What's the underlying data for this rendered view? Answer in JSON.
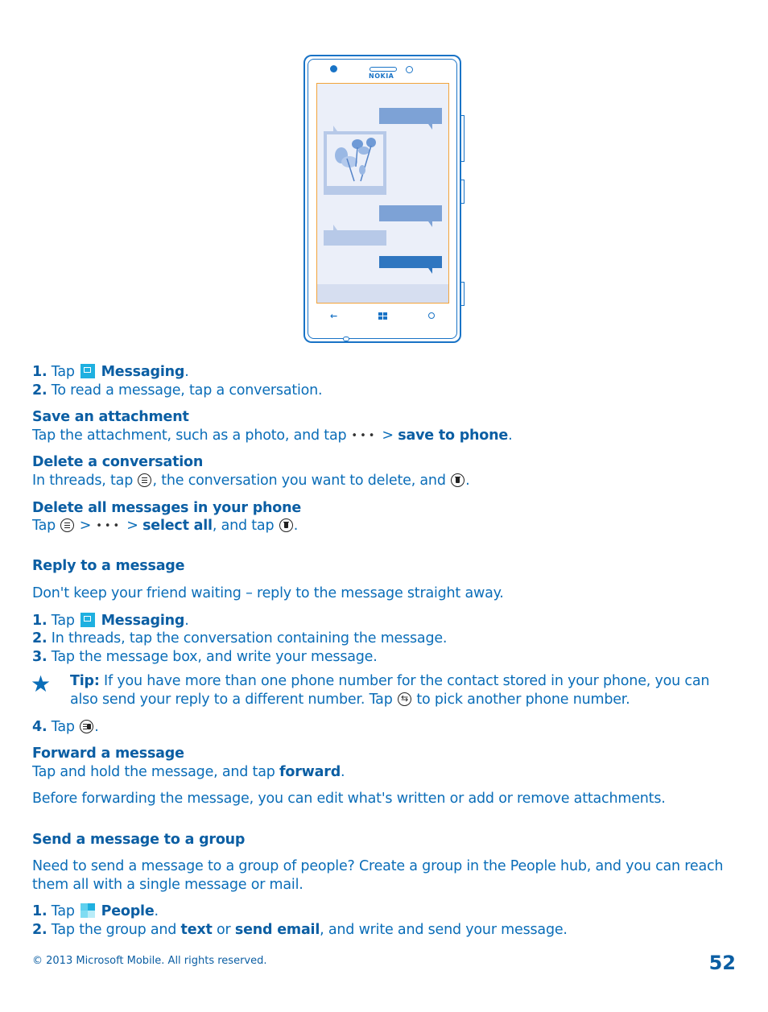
{
  "illustration": {
    "brand": "NOKIA",
    "colors": {
      "frame": "#1973c6",
      "screen_border": "#f2a33a",
      "screen_bg": "#ebeff9",
      "bubble_sent": "#7da2d6",
      "bubble_active": "#2f76c0",
      "bubble_received": "#b7c9e8"
    }
  },
  "section1": {
    "step1": {
      "num": "1.",
      "pre": " Tap ",
      "icon": "messaging-icon",
      "bold": "Messaging",
      "post": "."
    },
    "step2": {
      "num": "2.",
      "text": " To read a message, tap a conversation."
    }
  },
  "save_attachment": {
    "heading": "Save an attachment",
    "pre": "Tap the attachment, such as a photo, and tap",
    "dots": "•••",
    "gt": "> ",
    "bold": "save to phone",
    "post": "."
  },
  "delete_conversation": {
    "heading": "Delete a conversation",
    "pre": "In threads, tap ",
    "mid": ", the conversation you want to delete, and ",
    "post": "."
  },
  "delete_all": {
    "heading": "Delete all messages in your phone",
    "pre": "Tap ",
    "gt1": " >",
    "dots": "•••",
    "gt2": "> ",
    "bold": "select all",
    "mid": ", and tap ",
    "post": "."
  },
  "reply": {
    "heading": "Reply to a message",
    "intro": "Don't keep your friend waiting – reply to the message straight away.",
    "step1": {
      "num": "1.",
      "pre": " Tap ",
      "bold": "Messaging",
      "post": "."
    },
    "step2": {
      "num": "2.",
      "text": " In threads, tap the conversation containing the message."
    },
    "step3": {
      "num": "3.",
      "text": " Tap the message box, and write your message."
    },
    "tip": {
      "label": "Tip:",
      "line1": " If you have more than one phone number for the contact stored in your phone, you can",
      "line2_pre": "also send your reply to a different number. Tap ",
      "line2_post": " to pick another phone number."
    },
    "step4": {
      "num": "4.",
      "pre": " Tap ",
      "post": "."
    }
  },
  "forward": {
    "heading": "Forward a message",
    "pre": "Tap and hold the message, and tap ",
    "bold": "forward",
    "post": ".",
    "note": "Before forwarding the message, you can edit what's written or add or remove attachments."
  },
  "group": {
    "heading": "Send a message to a group",
    "intro1": "Need to send a message to a group of people? Create a group in the People hub, and you can reach",
    "intro2": "them all with a single message or mail.",
    "step1": {
      "num": "1.",
      "pre": " Tap ",
      "bold": "People",
      "post": "."
    },
    "step2": {
      "num": "2.",
      "pre": " Tap the group and ",
      "bold1": "text",
      "mid": " or ",
      "bold2": "send email",
      "post": ", and write and send your message."
    }
  },
  "footer": {
    "copyright": "© 2013 Microsoft Mobile. All rights reserved.",
    "page_number": "52"
  }
}
